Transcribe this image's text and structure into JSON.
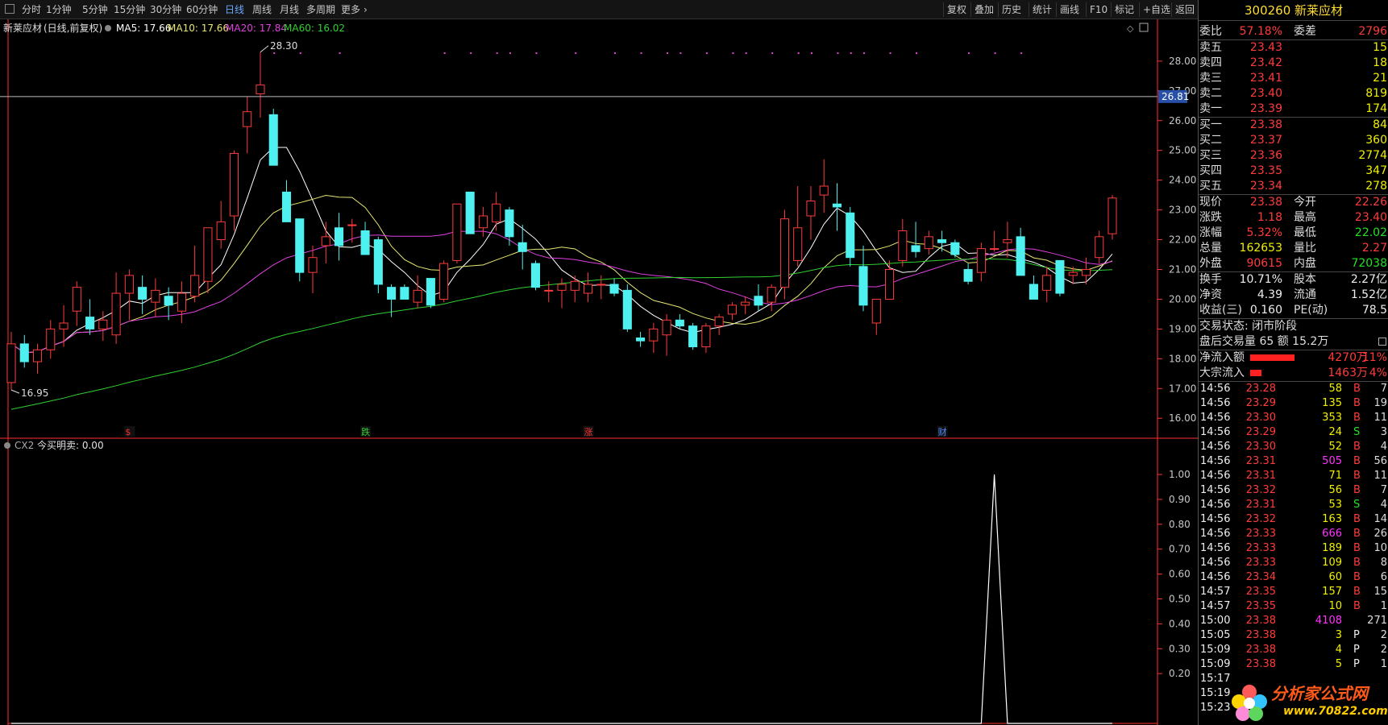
{
  "colors": {
    "up": "#ff3b3b",
    "down": "#4ff0f0",
    "ma5": "#ffffff",
    "ma10": "#e8e870",
    "ma20": "#e040e0",
    "ma60": "#30d030",
    "axis": "#ff3030"
  },
  "toolbar": {
    "periods": [
      "分时",
      "1分钟",
      "5分钟",
      "15分钟",
      "30分钟",
      "60分钟",
      "日线",
      "周线",
      "月线",
      "多周期",
      "更多"
    ],
    "active": "日线",
    "right": [
      "复权",
      "叠加",
      "历史",
      "统计",
      "画线",
      "F10",
      "标记",
      "+自选",
      "返回"
    ]
  },
  "chart_header": {
    "name": "新莱应材",
    "mode": "(日线,前复权)",
    "ma5": "MA5: 17.66",
    "ma10": "MA10: 17.66",
    "ma20": "MA20: 17.84",
    "ma60": "MA60: 16.02"
  },
  "chart_data": [
    {
      "type": "candlestick",
      "title": "新莱应材(日线,前复权)",
      "yticks": [
        "28.00",
        "27.00",
        "26.00",
        "25.00",
        "24.00",
        "23.00",
        "22.00",
        "21.00",
        "20.00",
        "19.00",
        "18.00",
        "17.00",
        "16.00"
      ],
      "ylim": [
        15.6,
        28.7
      ],
      "crosshair_price": "26.81",
      "high_label": "28.30",
      "low_label": "16.95",
      "ohlc": [
        [
          17.2,
          18.9,
          16.95,
          18.5
        ],
        [
          18.5,
          18.8,
          17.7,
          17.9
        ],
        [
          17.9,
          18.5,
          17.5,
          18.3
        ],
        [
          18.3,
          19.3,
          18.0,
          19.0
        ],
        [
          19.0,
          19.8,
          18.4,
          19.2
        ],
        [
          19.6,
          20.6,
          19.1,
          20.4
        ],
        [
          19.4,
          20.0,
          18.8,
          19.0
        ],
        [
          19.0,
          19.6,
          18.6,
          19.3
        ],
        [
          18.8,
          20.9,
          18.5,
          20.2
        ],
        [
          20.2,
          21.0,
          19.3,
          20.8
        ],
        [
          20.4,
          20.8,
          19.5,
          20.0
        ],
        [
          19.9,
          20.7,
          19.4,
          20.3
        ],
        [
          20.1,
          20.4,
          19.3,
          19.8
        ],
        [
          19.6,
          20.6,
          19.2,
          20.2
        ],
        [
          20.1,
          21.8,
          19.9,
          20.8
        ],
        [
          20.6,
          22.4,
          20.2,
          22.4
        ],
        [
          22.0,
          23.3,
          21.7,
          22.6
        ],
        [
          22.8,
          25.0,
          22.3,
          24.9
        ],
        [
          25.8,
          26.8,
          24.9,
          26.3
        ],
        [
          26.9,
          28.3,
          26.1,
          27.2
        ],
        [
          26.2,
          26.4,
          24.5,
          24.5
        ],
        [
          23.6,
          24.0,
          22.6,
          22.6
        ],
        [
          22.7,
          22.7,
          20.6,
          20.9
        ],
        [
          20.9,
          21.8,
          20.2,
          21.4
        ],
        [
          21.8,
          22.6,
          21.2,
          22.1
        ],
        [
          22.4,
          22.9,
          21.3,
          21.8
        ],
        [
          22.5,
          22.7,
          21.9,
          22.5
        ],
        [
          22.3,
          22.6,
          21.5,
          21.5
        ],
        [
          22.0,
          22.1,
          20.2,
          20.5
        ],
        [
          20.4,
          20.5,
          19.4,
          20.0
        ],
        [
          20.4,
          20.5,
          20.0,
          20.0
        ],
        [
          19.9,
          20.8,
          19.7,
          20.3
        ],
        [
          20.7,
          20.7,
          19.7,
          19.8
        ],
        [
          20.0,
          21.3,
          19.9,
          21.2
        ],
        [
          21.3,
          23.2,
          21.2,
          23.2
        ],
        [
          23.6,
          23.6,
          22.2,
          22.2
        ],
        [
          22.4,
          23.1,
          22.1,
          22.8
        ],
        [
          22.6,
          23.6,
          22.3,
          23.2
        ],
        [
          23.0,
          23.1,
          21.8,
          22.1
        ],
        [
          21.9,
          22.5,
          21.0,
          21.6
        ],
        [
          21.2,
          21.3,
          20.3,
          20.4
        ],
        [
          20.3,
          20.6,
          19.9,
          20.3
        ],
        [
          20.3,
          20.7,
          19.7,
          20.5
        ],
        [
          20.3,
          20.8,
          19.9,
          20.6
        ],
        [
          20.2,
          20.9,
          19.9,
          20.5
        ],
        [
          20.5,
          20.8,
          20.0,
          20.5
        ],
        [
          20.5,
          20.7,
          20.1,
          20.2
        ],
        [
          20.3,
          20.5,
          18.9,
          19.0
        ],
        [
          18.7,
          18.9,
          18.4,
          18.6
        ],
        [
          18.6,
          19.2,
          18.2,
          19.0
        ],
        [
          18.8,
          19.5,
          18.1,
          19.3
        ],
        [
          19.3,
          19.5,
          19.0,
          19.1
        ],
        [
          19.1,
          19.2,
          18.3,
          18.4
        ],
        [
          18.4,
          19.2,
          18.2,
          19.1
        ],
        [
          19.1,
          19.5,
          18.8,
          19.4
        ],
        [
          19.5,
          19.9,
          19.3,
          19.8
        ],
        [
          19.8,
          20.1,
          19.5,
          19.9
        ],
        [
          20.1,
          20.5,
          19.6,
          19.8
        ],
        [
          19.9,
          20.5,
          19.6,
          20.4
        ],
        [
          20.4,
          23.0,
          20.0,
          22.7
        ],
        [
          21.3,
          23.8,
          21.1,
          22.4
        ],
        [
          22.8,
          23.8,
          22.0,
          23.3
        ],
        [
          23.5,
          24.7,
          22.9,
          23.8
        ],
        [
          23.2,
          23.9,
          22.3,
          23.1
        ],
        [
          22.9,
          23.1,
          21.1,
          21.4
        ],
        [
          21.1,
          21.8,
          19.6,
          19.8
        ],
        [
          19.2,
          20.0,
          18.8,
          20.0
        ],
        [
          20.0,
          21.3,
          20.0,
          21.0
        ],
        [
          21.3,
          22.7,
          21.1,
          22.3
        ],
        [
          21.8,
          22.6,
          21.4,
          21.6
        ],
        [
          21.7,
          22.3,
          21.5,
          22.1
        ],
        [
          22.0,
          22.3,
          21.6,
          21.9
        ],
        [
          21.9,
          22.0,
          21.4,
          21.5
        ],
        [
          21.0,
          21.2,
          20.5,
          20.6
        ],
        [
          20.9,
          21.9,
          20.6,
          21.7
        ],
        [
          21.7,
          22.3,
          21.6,
          21.7
        ],
        [
          21.9,
          22.6,
          21.4,
          22.0
        ],
        [
          22.1,
          22.4,
          20.9,
          20.8
        ],
        [
          20.5,
          20.8,
          20.0,
          20.0
        ],
        [
          20.3,
          21.1,
          19.9,
          20.8
        ],
        [
          21.3,
          21.3,
          20.1,
          20.2
        ],
        [
          20.8,
          21.1,
          20.5,
          20.9
        ],
        [
          20.8,
          21.4,
          20.5,
          21.0
        ],
        [
          21.4,
          22.3,
          21.2,
          22.1
        ],
        [
          22.2,
          23.5,
          22.0,
          23.4
        ]
      ],
      "markers": [
        "$",
        "跌",
        "涨",
        "财"
      ]
    },
    {
      "type": "line",
      "title": "CX2 今买明卖: 0.00",
      "indicator_name": "CX2",
      "label": "今买明卖: 0.00",
      "yticks": [
        "1.00",
        "0.90",
        "0.80",
        "0.70",
        "0.60",
        "0.50",
        "0.40",
        "0.30",
        "0.20"
      ],
      "ylim": [
        0,
        1.0
      ],
      "spike_index": 75,
      "spike_value": 1.0
    }
  ],
  "side": {
    "title": "300260 新莱应材",
    "weibi": {
      "l1": "委比",
      "v1": "57.18%",
      "l2": "委差",
      "v2": "2796"
    },
    "asks": [
      {
        "label": "卖五",
        "price": "23.43",
        "vol": "15"
      },
      {
        "label": "卖四",
        "price": "23.42",
        "vol": "18"
      },
      {
        "label": "卖三",
        "price": "23.41",
        "vol": "21"
      },
      {
        "label": "卖二",
        "price": "23.40",
        "vol": "819"
      },
      {
        "label": "卖一",
        "price": "23.39",
        "vol": "174"
      }
    ],
    "bids": [
      {
        "label": "买一",
        "price": "23.38",
        "vol": "84"
      },
      {
        "label": "买二",
        "price": "23.37",
        "vol": "360"
      },
      {
        "label": "买三",
        "price": "23.36",
        "vol": "2774"
      },
      {
        "label": "买四",
        "price": "23.35",
        "vol": "347"
      },
      {
        "label": "买五",
        "price": "23.34",
        "vol": "278"
      }
    ],
    "stats": [
      {
        "l1": "现价",
        "v1": "23.38",
        "c1": "red",
        "l2": "今开",
        "v2": "22.26",
        "c2": "red"
      },
      {
        "l1": "涨跌",
        "v1": "1.18",
        "c1": "red",
        "l2": "最高",
        "v2": "23.40",
        "c2": "red"
      },
      {
        "l1": "涨幅",
        "v1": "5.32%",
        "c1": "red",
        "l2": "最低",
        "v2": "22.02",
        "c2": "green"
      },
      {
        "l1": "总量",
        "v1": "162653",
        "c1": "yellow",
        "l2": "量比",
        "v2": "2.27",
        "c2": "red"
      },
      {
        "l1": "外盘",
        "v1": "90615",
        "c1": "red",
        "l2": "内盘",
        "v2": "72038",
        "c2": "green"
      }
    ],
    "stats2": [
      {
        "l1": "换手",
        "v1": "10.71%",
        "l2": "股本",
        "v2": "2.27亿"
      },
      {
        "l1": "净资",
        "v1": "4.39",
        "l2": "流通",
        "v2": "1.52亿"
      },
      {
        "l1": "收益(三)",
        "v1": "0.160",
        "l2": "PE(动)",
        "v2": "78.5"
      }
    ],
    "trade_status": "交易状态: 闭市阶段",
    "after_hours": "盘后交易量 65 额 15.2万",
    "flows": [
      {
        "label": "净流入额",
        "bar": 0.55,
        "value": "4270万",
        "pct": "11%"
      },
      {
        "label": "大宗流入",
        "bar": 0.14,
        "value": "1463万",
        "pct": "4%"
      }
    ],
    "ticks": [
      {
        "t": "14:56",
        "p": "23.28",
        "v": "58",
        "bs": "B",
        "n": "7",
        "vc": "yellow"
      },
      {
        "t": "14:56",
        "p": "23.29",
        "v": "135",
        "bs": "B",
        "n": "19",
        "vc": "yellow"
      },
      {
        "t": "14:56",
        "p": "23.30",
        "v": "353",
        "bs": "B",
        "n": "11",
        "vc": "yellow"
      },
      {
        "t": "14:56",
        "p": "23.29",
        "v": "24",
        "bs": "S",
        "n": "3",
        "vc": "yellow"
      },
      {
        "t": "14:56",
        "p": "23.30",
        "v": "52",
        "bs": "B",
        "n": "4",
        "vc": "yellow"
      },
      {
        "t": "14:56",
        "p": "23.31",
        "v": "505",
        "bs": "B",
        "n": "56",
        "vc": "magenta"
      },
      {
        "t": "14:56",
        "p": "23.31",
        "v": "71",
        "bs": "B",
        "n": "11",
        "vc": "yellow"
      },
      {
        "t": "14:56",
        "p": "23.32",
        "v": "56",
        "bs": "B",
        "n": "7",
        "vc": "yellow"
      },
      {
        "t": "14:56",
        "p": "23.31",
        "v": "53",
        "bs": "S",
        "n": "4",
        "vc": "yellow"
      },
      {
        "t": "14:56",
        "p": "23.32",
        "v": "163",
        "bs": "B",
        "n": "14",
        "vc": "yellow"
      },
      {
        "t": "14:56",
        "p": "23.33",
        "v": "666",
        "bs": "B",
        "n": "26",
        "vc": "magenta"
      },
      {
        "t": "14:56",
        "p": "23.33",
        "v": "189",
        "bs": "B",
        "n": "10",
        "vc": "yellow"
      },
      {
        "t": "14:56",
        "p": "23.33",
        "v": "109",
        "bs": "B",
        "n": "8",
        "vc": "yellow"
      },
      {
        "t": "14:56",
        "p": "23.34",
        "v": "60",
        "bs": "B",
        "n": "6",
        "vc": "yellow"
      },
      {
        "t": "14:57",
        "p": "23.35",
        "v": "157",
        "bs": "B",
        "n": "15",
        "vc": "yellow"
      },
      {
        "t": "14:57",
        "p": "23.35",
        "v": "10",
        "bs": "B",
        "n": "1",
        "vc": "yellow"
      },
      {
        "t": "15:00",
        "p": "23.38",
        "v": "4108",
        "bs": "",
        "n": "271",
        "vc": "magenta"
      },
      {
        "t": "15:05",
        "p": "23.38",
        "v": "3",
        "bs": "P",
        "n": "2",
        "vc": "yellow"
      },
      {
        "t": "15:09",
        "p": "23.38",
        "v": "4",
        "bs": "P",
        "n": "2",
        "vc": "yellow"
      },
      {
        "t": "15:09",
        "p": "23.38",
        "v": "5",
        "bs": "P",
        "n": "1",
        "vc": "yellow"
      },
      {
        "t": "15:17",
        "p": "",
        "v": "",
        "bs": "",
        "n": "",
        "vc": "yellow"
      },
      {
        "t": "15:19",
        "p": "",
        "v": "",
        "bs": "",
        "n": "",
        "vc": "yellow"
      },
      {
        "t": "15:23",
        "p": "",
        "v": "",
        "bs": "",
        "n": "",
        "vc": "yellow"
      }
    ]
  },
  "watermark": {
    "text": "分析家公式网",
    "url": "www.70822.com"
  }
}
